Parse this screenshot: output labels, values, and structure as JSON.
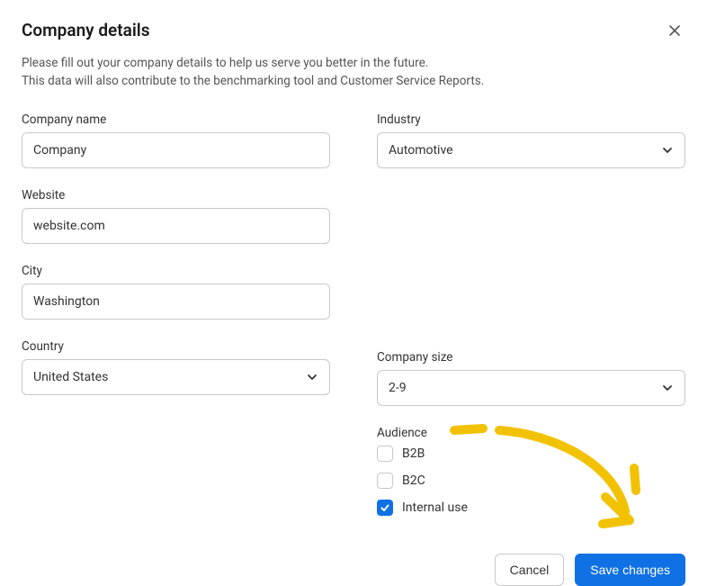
{
  "title": "Company details",
  "description_line1": "Please fill out your company details to help us serve you better in the future.",
  "description_line2": "This data will also contribute to the benchmarking tool and Customer Service Reports.",
  "fields": {
    "company_name": {
      "label": "Company name",
      "value": "Company"
    },
    "website": {
      "label": "Website",
      "value": "website.com"
    },
    "city": {
      "label": "City",
      "value": "Washington"
    },
    "country": {
      "label": "Country",
      "value": "United States"
    },
    "industry": {
      "label": "Industry",
      "value": "Automotive"
    },
    "company_size": {
      "label": "Company size",
      "value": "2-9"
    },
    "audience": {
      "label": "Audience",
      "options": [
        {
          "label": "B2B",
          "checked": false
        },
        {
          "label": "B2C",
          "checked": false
        },
        {
          "label": "Internal use",
          "checked": true
        }
      ]
    }
  },
  "buttons": {
    "cancel": "Cancel",
    "save": "Save changes"
  },
  "annotation": {
    "color": "#f2c200"
  }
}
